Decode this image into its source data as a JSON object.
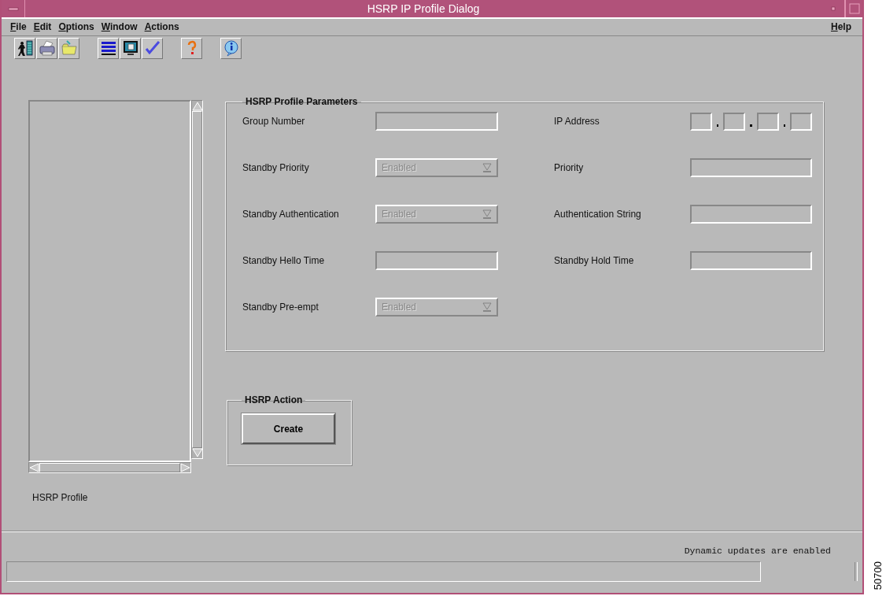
{
  "window": {
    "title": "HSRP IP Profile Dialog"
  },
  "menu": [
    {
      "label": "File"
    },
    {
      "label": "Edit"
    },
    {
      "label": "Options"
    },
    {
      "label": "Window"
    },
    {
      "label": "Actions"
    }
  ],
  "help_menu": {
    "label": "Help"
  },
  "profile_list": {
    "label": "HSRP Profile"
  },
  "parameters": {
    "legend": "HSRP Profile Parameters",
    "rows": [
      [
        {
          "label": "Group Number",
          "kind": "text"
        },
        {
          "label": "IP Address",
          "kind": "ip"
        }
      ],
      [
        {
          "label": "Standby Priority",
          "kind": "select",
          "value": "Enabled",
          "disabled": true
        },
        {
          "label": "Priority",
          "kind": "text"
        }
      ],
      [
        {
          "label": "Standby Authentication",
          "kind": "select",
          "value": "Enabled",
          "disabled": true
        },
        {
          "label": "Authentication String",
          "kind": "text"
        }
      ],
      [
        {
          "label": "Standby Hello Time",
          "kind": "text"
        },
        {
          "label": "Standby Hold Time",
          "kind": "text"
        }
      ],
      [
        {
          "label": "Standby Pre-empt",
          "kind": "select",
          "value": "Enabled",
          "disabled": true
        }
      ]
    ]
  },
  "action": {
    "legend": "HSRP Action",
    "button": "Create"
  },
  "status_bar": {
    "message": "Dynamic updates are enabled"
  },
  "figure_number": "50700"
}
